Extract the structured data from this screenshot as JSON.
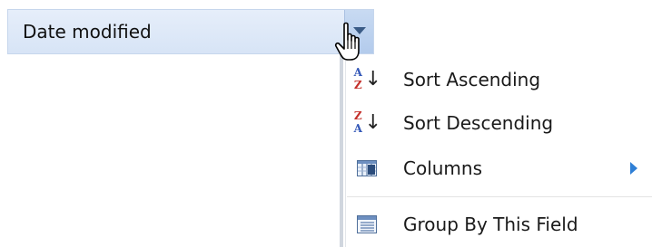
{
  "header": {
    "label": "Date modified"
  },
  "menu": {
    "items": [
      {
        "label": "Sort Ascending",
        "icon": "sort-ascending-icon",
        "icon_top": "A",
        "icon_bottom": "Z"
      },
      {
        "label": "Sort Descending",
        "icon": "sort-descending-icon",
        "icon_top": "Z",
        "icon_bottom": "A"
      },
      {
        "label": "Columns",
        "icon": "columns-icon",
        "has_submenu": true
      },
      {
        "label": "Group By This Field",
        "icon": "group-by-icon"
      }
    ]
  },
  "colors": {
    "header_bg": "#dce7f7",
    "trigger_bg": "#bcd2ef",
    "submenu_arrow": "#2f7fd6",
    "ascending_top": "#3559b8",
    "ascending_bottom": "#c4302b"
  }
}
